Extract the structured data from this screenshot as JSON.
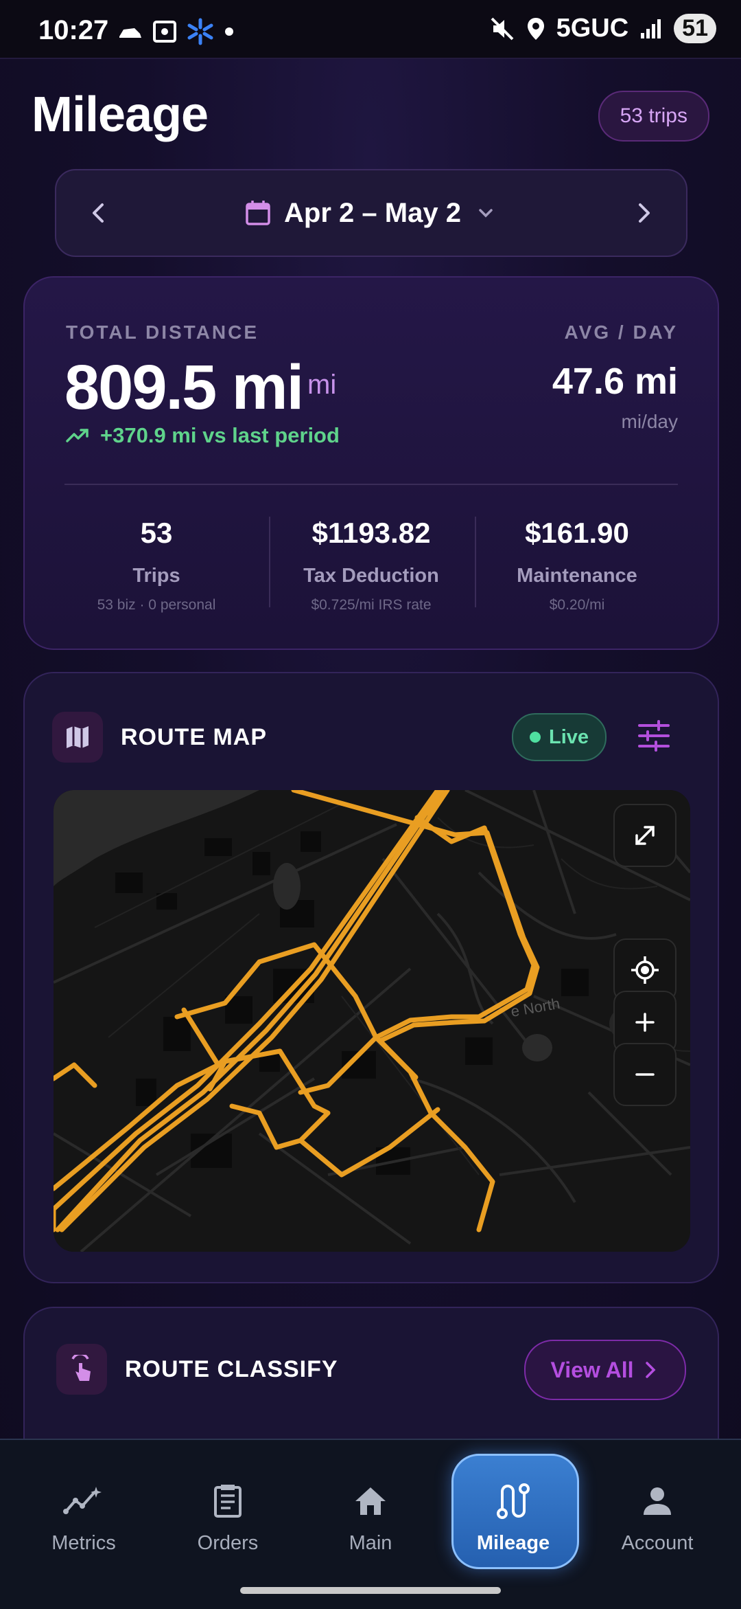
{
  "status_bar": {
    "time": "10:27",
    "network": "5GUC",
    "battery": "51"
  },
  "header": {
    "title": "Mileage",
    "trips_badge": "53 trips"
  },
  "date_range": {
    "label": "Apr 2 – May 2"
  },
  "summary": {
    "total_label": "TOTAL DISTANCE",
    "total_value": "809.5 mi",
    "total_unit": "mi",
    "delta": "+370.9 mi vs last period",
    "avg_label": "AVG / DAY",
    "avg_value": "47.6 mi",
    "avg_sub": "mi/day",
    "stats": [
      {
        "value": "53",
        "label": "Trips",
        "sub": "53 biz · 0 personal"
      },
      {
        "value": "$1193.82",
        "label": "Tax Deduction",
        "sub": "$0.725/mi IRS rate"
      },
      {
        "value": "$161.90",
        "label": "Maintenance",
        "sub": "$0.20/mi"
      }
    ]
  },
  "route_map": {
    "title": "ROUTE MAP",
    "live_label": "Live",
    "map_label": "e North"
  },
  "route_classify": {
    "title": "ROUTE CLASSIFY",
    "view_all": "View All"
  },
  "nav": [
    {
      "label": "Metrics",
      "icon": "metrics-icon"
    },
    {
      "label": "Orders",
      "icon": "orders-icon"
    },
    {
      "label": "Main",
      "icon": "home-icon"
    },
    {
      "label": "Mileage",
      "icon": "route-icon",
      "active": true
    },
    {
      "label": "Account",
      "icon": "account-icon"
    }
  ],
  "colors": {
    "accent": "#c792ea",
    "route": "#f5a623",
    "positive": "#5fd38b",
    "live": "#4fe0a0",
    "nav_active": "#2f6fc4"
  }
}
